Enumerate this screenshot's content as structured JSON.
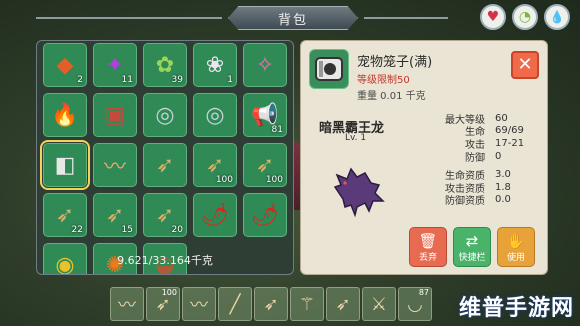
{
  "window": {
    "title": "背包"
  },
  "top_icons": [
    {
      "name": "heart-icon",
      "glyph": "♥",
      "color": "#d1334a"
    },
    {
      "name": "stomach-icon",
      "glyph": "◔",
      "color": "#7bb83a"
    },
    {
      "name": "water-drop-icon",
      "glyph": "💧",
      "color": "#2f8fc2"
    }
  ],
  "inventory": {
    "slots": [
      {
        "icon": "crystal",
        "count": "2",
        "glyph": "◆",
        "color": "#e35e2a"
      },
      {
        "icon": "purple-gem",
        "count": "11",
        "glyph": "✦",
        "color": "#b23de0"
      },
      {
        "icon": "herb",
        "count": "39",
        "glyph": "✿",
        "color": "#9bd45a"
      },
      {
        "icon": "flower",
        "count": "1",
        "glyph": "❀",
        "color": "#f0e4f0"
      },
      {
        "icon": "pink-item",
        "count": "",
        "glyph": "✧",
        "color": "#f06fb0"
      },
      {
        "icon": "fire-orb",
        "count": "",
        "glyph": "🔥",
        "color": "#f28a1a"
      },
      {
        "icon": "lantern",
        "count": "",
        "glyph": "▣",
        "color": "#c64a3c"
      },
      {
        "icon": "disc",
        "count": "",
        "glyph": "◎",
        "color": "#c8d2d8"
      },
      {
        "icon": "disc",
        "count": "",
        "glyph": "◎",
        "color": "#c8d2d8"
      },
      {
        "icon": "megaphone",
        "count": "81",
        "glyph": "📢",
        "color": "#f2f2f2"
      },
      {
        "icon": "pet-cage",
        "count": "",
        "glyph": "◧",
        "color": "#e8e8e8"
      },
      {
        "icon": "feather",
        "count": "",
        "glyph": "〰",
        "color": "#f2a86a"
      },
      {
        "icon": "arrows",
        "count": "",
        "glyph": "➶",
        "color": "#d6b36a"
      },
      {
        "icon": "arrows",
        "count": "100",
        "glyph": "➶",
        "color": "#d6b36a"
      },
      {
        "icon": "arrows",
        "count": "100",
        "glyph": "➶",
        "color": "#d6b36a"
      },
      {
        "icon": "arrows",
        "count": "22",
        "glyph": "➶",
        "color": "#d6b36a"
      },
      {
        "icon": "arrows",
        "count": "15",
        "glyph": "➶",
        "color": "#d6b36a"
      },
      {
        "icon": "arrows",
        "count": "20",
        "glyph": "➶",
        "color": "#d6b36a"
      },
      {
        "icon": "chili-pepper",
        "count": "",
        "glyph": "🌶",
        "color": "#d8281e"
      },
      {
        "icon": "chili-bundle",
        "count": "",
        "glyph": "🌶",
        "color": "#d8281e"
      },
      {
        "icon": "gold-pot",
        "count": "",
        "glyph": "◉",
        "color": "#e8c22a"
      },
      {
        "icon": "orange-flower",
        "count": "",
        "glyph": "✺",
        "color": "#ef7a1e"
      },
      {
        "icon": "seed-bag",
        "count": "",
        "glyph": "◒",
        "color": "#b05a3a"
      }
    ],
    "weight_text": "9.621/33.164千克"
  },
  "detail": {
    "item_name": "宠物笼子(满)",
    "level_limit": "等级限制50",
    "weight": "重量 0.01 千克",
    "close_glyph": "✕",
    "pet_name": "暗黑霸王龙",
    "pet_level": "Lv. 1",
    "stats": [
      {
        "label": "最大等级",
        "value": "60"
      },
      {
        "label": "生命",
        "value": "69/69"
      },
      {
        "label": "攻击",
        "value": "17-21"
      },
      {
        "label": "防御",
        "value": "0"
      }
    ],
    "aptitudes": [
      {
        "label": "生命资质",
        "value": "3.0"
      },
      {
        "label": "攻击资质",
        "value": "1.8"
      },
      {
        "label": "防御资质",
        "value": "0.0"
      }
    ],
    "buttons": {
      "discard": "丢弃",
      "quick_bar": "快捷栏",
      "use": "使用"
    }
  },
  "hotbar": [
    {
      "icon": "feather",
      "count": "",
      "glyph": "〰"
    },
    {
      "icon": "arrows",
      "count": "100",
      "glyph": "➶"
    },
    {
      "icon": "feather",
      "count": "",
      "glyph": "〰"
    },
    {
      "icon": "torch",
      "count": "",
      "glyph": "╱"
    },
    {
      "icon": "arrows",
      "count": "",
      "glyph": "➶"
    },
    {
      "icon": "trident",
      "count": "",
      "glyph": "⚚"
    },
    {
      "icon": "arrows",
      "count": "",
      "glyph": "➶"
    },
    {
      "icon": "sword",
      "count": "",
      "glyph": "⚔"
    },
    {
      "icon": "bowl",
      "count": "87",
      "glyph": "◡"
    }
  ],
  "watermark": "维普手游网"
}
